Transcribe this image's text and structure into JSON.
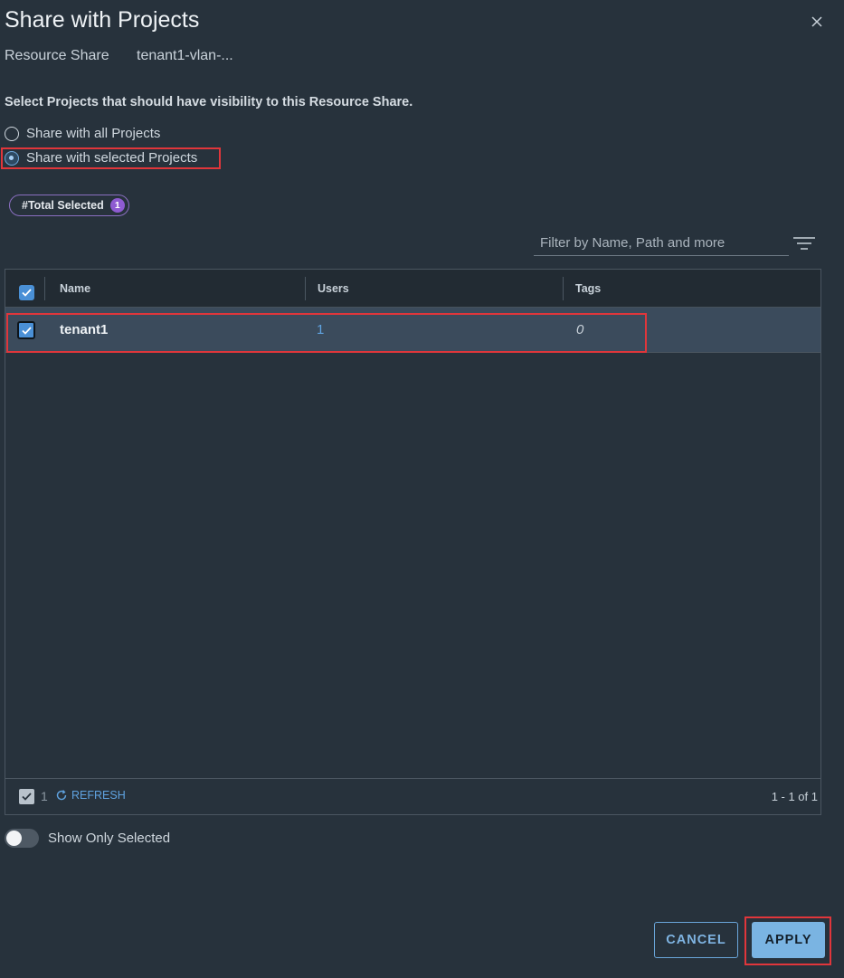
{
  "dialog": {
    "title": "Share with Projects",
    "resource_share_label": "Resource Share",
    "resource_share_value": "tenant1-vlan-...",
    "instruction": "Select Projects that should have visibility to this Resource Share."
  },
  "visibility": {
    "options": [
      {
        "label": "Share with all Projects",
        "selected": false
      },
      {
        "label": "Share with selected Projects",
        "selected": true
      }
    ]
  },
  "selection_badge": {
    "label": "#Total Selected",
    "count": "1"
  },
  "filter": {
    "placeholder": "Filter by Name, Path and more",
    "value": ""
  },
  "table": {
    "columns": [
      "Name",
      "Users",
      "Tags"
    ],
    "rows": [
      {
        "name": "tenant1",
        "users": "1",
        "tags": "0",
        "selected": true
      }
    ],
    "footer": {
      "selected_count": "1",
      "refresh_label": "REFRESH",
      "pagination": "1 - 1 of 1"
    }
  },
  "show_only_selected": {
    "label": "Show Only Selected",
    "on": false
  },
  "actions": {
    "cancel_label": "CANCEL",
    "apply_label": "APPLY"
  },
  "icons": {
    "close": "close-icon",
    "filter": "filter-lines-icon",
    "refresh": "refresh-icon",
    "check": "checkmark-icon"
  },
  "colors": {
    "background": "#27323c",
    "selected_row": "#3b4b5c",
    "accent": "#4a90d6",
    "link": "#5fa3e0",
    "badge": "#8e5bd1",
    "highlight": "#e0363b",
    "apply_button": "#7ab4e2"
  }
}
